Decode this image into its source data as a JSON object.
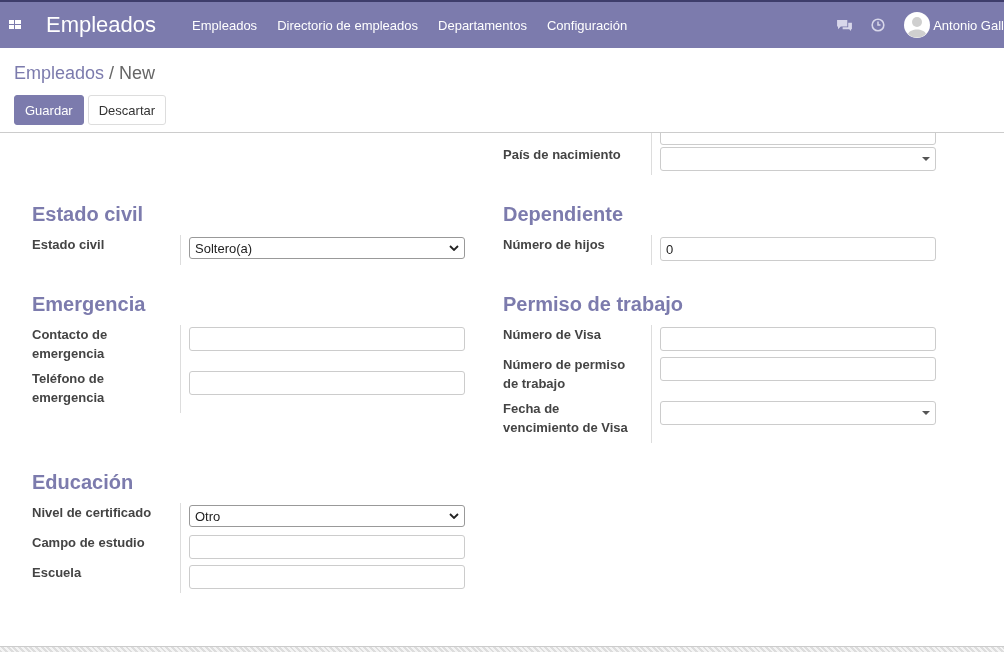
{
  "navbar": {
    "app_title": "Empleados",
    "menu": [
      "Empleados",
      "Directorio de empleados",
      "Departamentos",
      "Configuración"
    ],
    "user": "Antonio Gall"
  },
  "breadcrumb": {
    "parent": "Empleados",
    "current": "/ New"
  },
  "buttons": [
    {
      "label": "Guardar",
      "kind": "primary"
    },
    {
      "label": "Descartar",
      "kind": "secondary"
    }
  ],
  "top_fields": [
    {
      "label": "País de nacimiento",
      "kind": "dropdown"
    }
  ],
  "sections": [
    {
      "title": "Estado civil",
      "fields": [
        {
          "label": "Estado civil",
          "kind": "select",
          "value": "Soltero(a)"
        }
      ]
    },
    {
      "title": "Dependiente",
      "fields": [
        {
          "label": "Número de hijos",
          "kind": "text",
          "value": "0"
        }
      ]
    },
    {
      "title": "Emergencia",
      "fields": [
        {
          "label": "Contacto de emergencia",
          "kind": "text"
        },
        {
          "label": "Teléfono de emergencia",
          "kind": "text"
        }
      ]
    },
    {
      "title": "Permiso de trabajo",
      "fields": [
        {
          "label": "Número de Visa",
          "kind": "text"
        },
        {
          "label": "Número de permiso de trabajo",
          "kind": "text"
        },
        {
          "label": "Fecha de vencimiento de Visa",
          "kind": "dropdown"
        }
      ]
    },
    {
      "title": "Educación",
      "fields": [
        {
          "label": "Nivel de certificado",
          "kind": "select",
          "value": "Otro"
        },
        {
          "label": "Campo de estudio",
          "kind": "text"
        },
        {
          "label": "Escuela",
          "kind": "text"
        }
      ]
    }
  ]
}
